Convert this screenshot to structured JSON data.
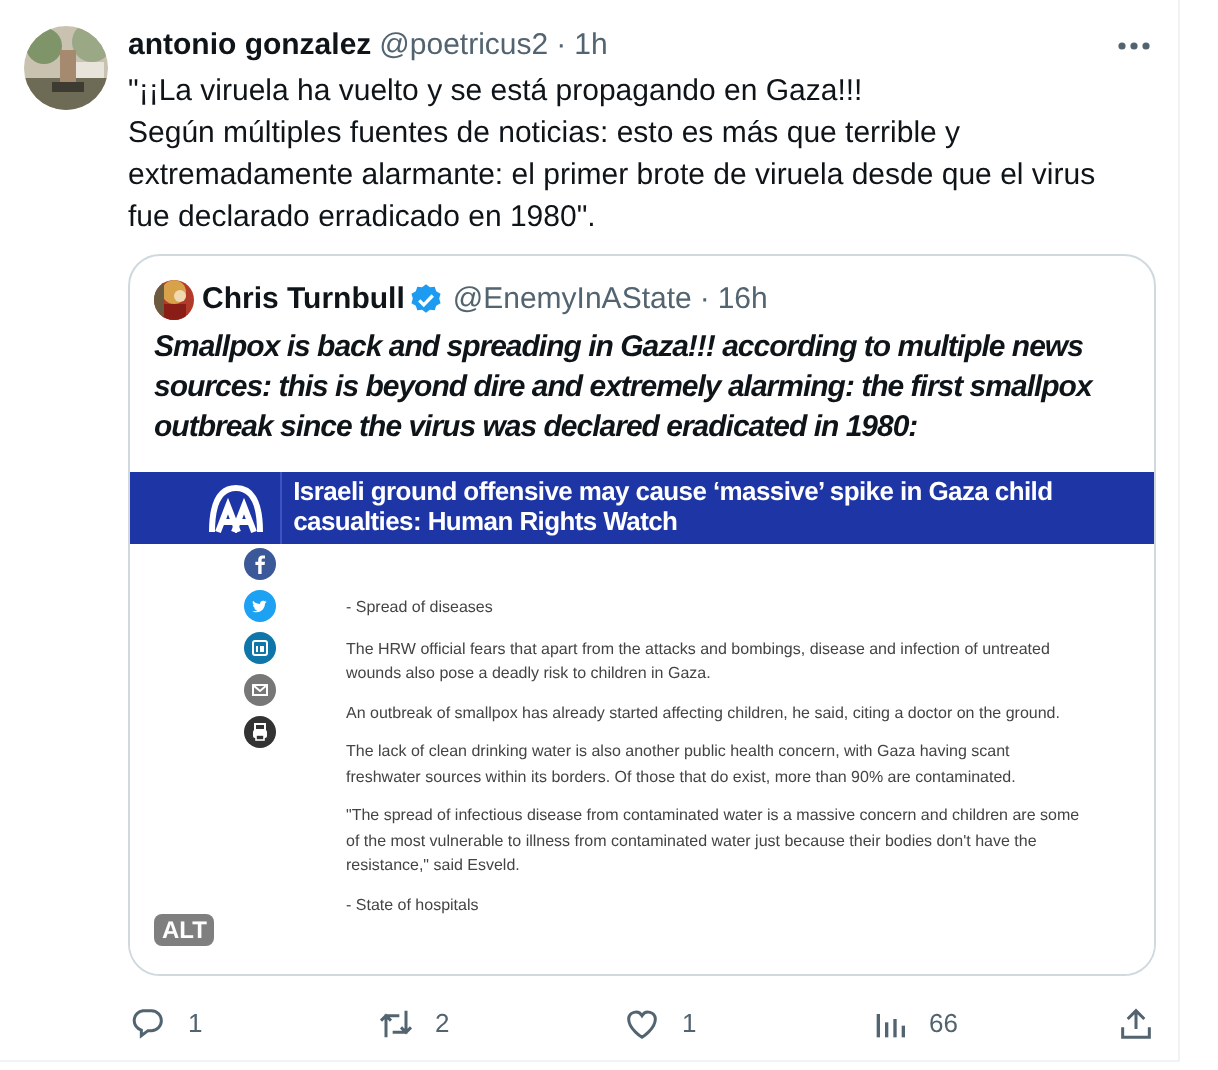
{
  "tweet": {
    "author": {
      "name": "antonio gonzalez",
      "handle": "@poetricus2",
      "separator": "·",
      "time": "1h"
    },
    "text": [
      "\"¡¡La viruela ha vuelto y se está propagando en Gaza!!!",
      "Según múltiples fuentes de noticias: esto es más que terrible y extremadamente alarmante: el primer brote de viruela desde que el virus fue declarado erradicado en 1980\"."
    ],
    "quote": {
      "author": {
        "name": "Chris Turnbull",
        "verified": true,
        "handle": "@EnemyInAState",
        "separator": "·",
        "time": "16h"
      },
      "text": "Smallpox is back and spreading in Gaza!!! according to multiple news sources: this is beyond dire and extremely alarming: the first smallpox outbreak since the virus was declared eradicated in 1980:",
      "media": {
        "headline": "Israeli ground offensive may cause ‘massive’ spike in Gaza child casualties: Human Rights Watch",
        "blocks": [
          {
            "kind": "heading",
            "text": "- Spread of diseases"
          },
          {
            "kind": "paragraph",
            "text": "The HRW official fears that apart from the attacks and bombings, disease and infection of untreated wounds also pose a deadly risk to children in Gaza."
          },
          {
            "kind": "paragraph",
            "text": "An outbreak of smallpox has already started affecting children, he said, citing a doctor on the ground."
          },
          {
            "kind": "paragraph",
            "text": "The lack of clean drinking water is also another public health concern, with Gaza having scant freshwater sources within its borders. Of those that do exist, more than 90% are contaminated."
          },
          {
            "kind": "paragraph",
            "text": "\"The spread of infectious disease from contaminated water is a massive concern and children are some of the most vulnerable to illness from contaminated water just because their bodies don't have the resistance,\" said Esveld."
          },
          {
            "kind": "heading",
            "text": "- State of hospitals"
          }
        ],
        "alt_badge": "ALT"
      }
    },
    "actions": [
      {
        "kind": "reply",
        "count": "1"
      },
      {
        "kind": "repost",
        "count": "2"
      },
      {
        "kind": "like",
        "count": "1"
      },
      {
        "kind": "views",
        "count": "66"
      },
      {
        "kind": "share"
      }
    ]
  }
}
